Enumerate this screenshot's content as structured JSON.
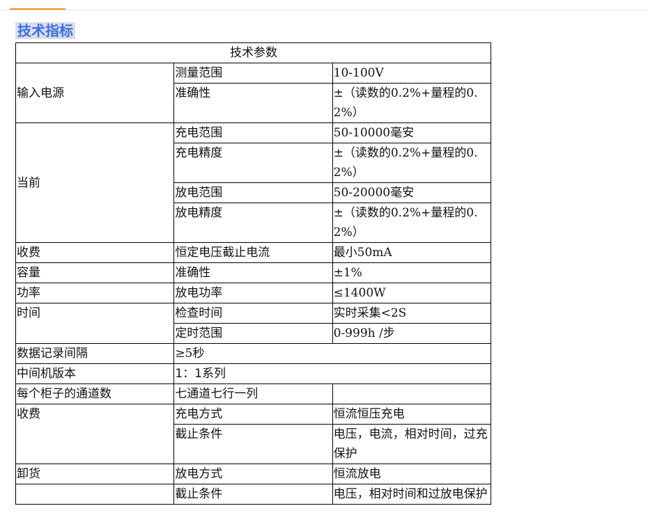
{
  "section": {
    "title": "技术指标"
  },
  "table": {
    "header": "技术参数",
    "input_power": {
      "label": "输入电源",
      "rows": [
        {
          "name": "测量范围",
          "value": "10-100V"
        },
        {
          "name": "准确性",
          "value": "±（读数的0.2%+量程的0.2%）"
        }
      ]
    },
    "current": {
      "label": "当前",
      "rows": [
        {
          "name": "充电范围",
          "value": "50-10000毫安"
        },
        {
          "name": "充电精度",
          "value": "±（读数的0.2%+量程的0.2%）"
        },
        {
          "name": "放电范围",
          "value": "50-20000毫安"
        },
        {
          "name": "放电精度",
          "value": "±（读数的0.2%+量程的0.2%）"
        }
      ]
    },
    "charge_fee": {
      "label": "收费",
      "rows": [
        {
          "name": "恒定电压截止电流",
          "value": "最小50mA"
        }
      ]
    },
    "capacity": {
      "label": "容量",
      "rows": [
        {
          "name": "准确性",
          "value": "±1%"
        }
      ]
    },
    "power": {
      "label": "功率",
      "rows": [
        {
          "name": "放电功率",
          "value": "≤1400W"
        }
      ]
    },
    "time": {
      "label": "时间",
      "rows": [
        {
          "name": "检查时间",
          "value": "实时采集<2S"
        },
        {
          "name": "定时范围",
          "value": "0-999h /步"
        }
      ]
    },
    "data_interval": {
      "label": "数据记录间隔",
      "value": "≥5秒"
    },
    "middle_version": {
      "label": "中间机版本",
      "value": "1：1系列"
    },
    "channels": {
      "label": "每个柜子的通道数",
      "value": "七通道七行一列",
      "extra": ""
    },
    "charge": {
      "label": "收费",
      "rows": [
        {
          "name": "充电方式",
          "value": "恒流恒压充电"
        },
        {
          "name": "截止条件",
          "value": "电压，电流，相对时间，过充保护"
        }
      ]
    },
    "discharge": {
      "label": "卸货",
      "rows": [
        {
          "name": "放电方式",
          "value": "恒流放电"
        },
        {
          "name": "截止条件",
          "value": "电压，相对时间和过放电保护"
        }
      ]
    }
  }
}
